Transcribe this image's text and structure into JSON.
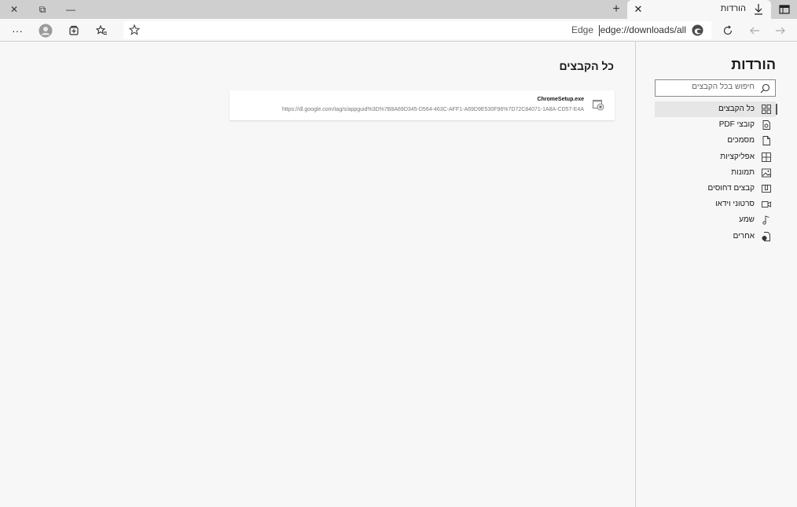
{
  "window": {
    "close_glyph": "✕",
    "restore_glyph": "⧉",
    "minimize_glyph": "—"
  },
  "tab": {
    "title": "הורדות",
    "close_glyph": "✕",
    "icon": "download-icon"
  },
  "newtab_glyph": "+",
  "toolbar": {
    "more_glyph": "···",
    "url": "edge://downloads/all",
    "brand": "Edge"
  },
  "sidebar": {
    "title": "הורדות",
    "search_placeholder": "חיפוש בכל הקבצים",
    "items": [
      {
        "label": "כל הקבצים",
        "icon": "grid-icon",
        "active": true
      },
      {
        "label": "קובצי PDF",
        "icon": "pdf-icon"
      },
      {
        "label": "מסמכים",
        "icon": "document-icon"
      },
      {
        "label": "אפליקציות",
        "icon": "apps-icon"
      },
      {
        "label": "תמונות",
        "icon": "image-icon"
      },
      {
        "label": "קבצים דחוסים",
        "icon": "archive-icon"
      },
      {
        "label": "סרטוני וידאו",
        "icon": "video-icon"
      },
      {
        "label": "שמע",
        "icon": "music-icon"
      },
      {
        "label": "אחרים",
        "icon": "other-file-icon"
      }
    ]
  },
  "main": {
    "title": "כל הקבצים",
    "downloads": [
      {
        "filename": "ChromeSetup.exe",
        "url": "https://dl.google.com/tag/s/appguid%3D%7B8A69D345-D564-463C-AFF1-A69D9E530F96%7D72C84071-1A8A-CD57-E4A"
      }
    ]
  },
  "colors": {
    "titlebar": "#cfcfcf",
    "background": "#f7f7f7",
    "card": "#ffffff",
    "active_item": "#e6e6e6"
  }
}
